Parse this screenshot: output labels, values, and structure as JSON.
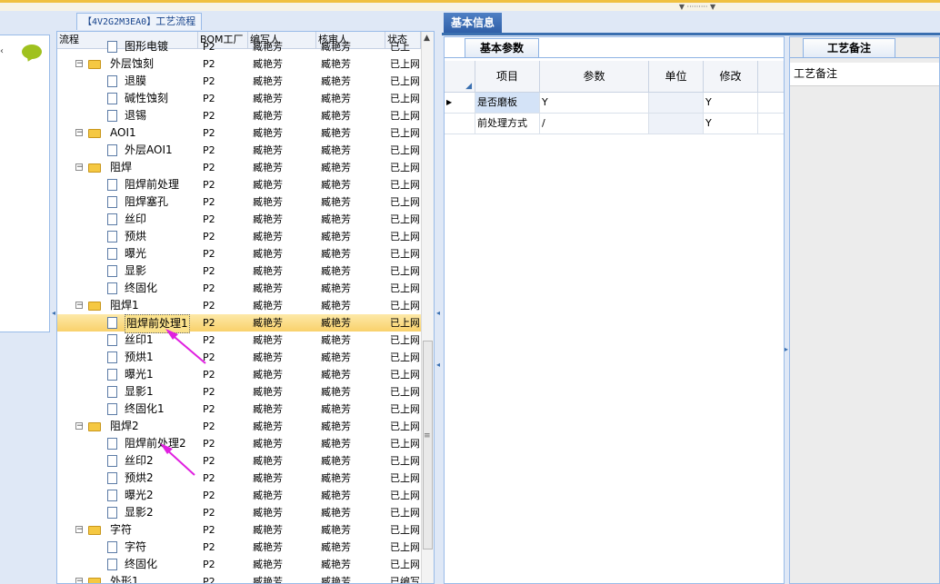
{
  "colors": {
    "accent": "#3a6fb0",
    "selected_row": "#f9d16b",
    "folder": "#f5c842",
    "annotation_arrow": "#e020e0"
  },
  "tree_panel": {
    "title_code": "【4V2G2M3EA0】",
    "title_text": "工艺流程",
    "headers": [
      "流程",
      "BOM工厂",
      "编写人",
      "核审人",
      "状态"
    ],
    "rows": [
      {
        "level": 1,
        "type": "doc",
        "name": "图形电镀",
        "bom": "P2",
        "writer": "臧艳芳",
        "reviewer": "臧艳芳",
        "status": "已上"
      },
      {
        "level": 0,
        "type": "folder",
        "name": "外层蚀刻",
        "bom": "P2",
        "writer": "臧艳芳",
        "reviewer": "臧艳芳",
        "status": "已上网"
      },
      {
        "level": 1,
        "type": "doc",
        "name": "退膜",
        "bom": "P2",
        "writer": "臧艳芳",
        "reviewer": "臧艳芳",
        "status": "已上网"
      },
      {
        "level": 1,
        "type": "doc",
        "name": "碱性蚀刻",
        "bom": "P2",
        "writer": "臧艳芳",
        "reviewer": "臧艳芳",
        "status": "已上网"
      },
      {
        "level": 1,
        "type": "doc",
        "name": "退锡",
        "bom": "P2",
        "writer": "臧艳芳",
        "reviewer": "臧艳芳",
        "status": "已上网"
      },
      {
        "level": 0,
        "type": "folder",
        "name": "AOI1",
        "bom": "P2",
        "writer": "臧艳芳",
        "reviewer": "臧艳芳",
        "status": "已上网"
      },
      {
        "level": 1,
        "type": "doc",
        "name": "外层AOI1",
        "bom": "P2",
        "writer": "臧艳芳",
        "reviewer": "臧艳芳",
        "status": "已上网"
      },
      {
        "level": 0,
        "type": "folder",
        "name": "阻焊",
        "bom": "P2",
        "writer": "臧艳芳",
        "reviewer": "臧艳芳",
        "status": "已上网"
      },
      {
        "level": 1,
        "type": "doc",
        "name": "阻焊前处理",
        "bom": "P2",
        "writer": "臧艳芳",
        "reviewer": "臧艳芳",
        "status": "已上网"
      },
      {
        "level": 1,
        "type": "doc",
        "name": "阻焊塞孔",
        "bom": "P2",
        "writer": "臧艳芳",
        "reviewer": "臧艳芳",
        "status": "已上网"
      },
      {
        "level": 1,
        "type": "doc",
        "name": "丝印",
        "bom": "P2",
        "writer": "臧艳芳",
        "reviewer": "臧艳芳",
        "status": "已上网"
      },
      {
        "level": 1,
        "type": "doc",
        "name": "预烘",
        "bom": "P2",
        "writer": "臧艳芳",
        "reviewer": "臧艳芳",
        "status": "已上网"
      },
      {
        "level": 1,
        "type": "doc",
        "name": "曝光",
        "bom": "P2",
        "writer": "臧艳芳",
        "reviewer": "臧艳芳",
        "status": "已上网"
      },
      {
        "level": 1,
        "type": "doc",
        "name": "显影",
        "bom": "P2",
        "writer": "臧艳芳",
        "reviewer": "臧艳芳",
        "status": "已上网"
      },
      {
        "level": 1,
        "type": "doc",
        "name": "终固化",
        "bom": "P2",
        "writer": "臧艳芳",
        "reviewer": "臧艳芳",
        "status": "已上网"
      },
      {
        "level": 0,
        "type": "folder",
        "name": "阻焊1",
        "bom": "P2",
        "writer": "臧艳芳",
        "reviewer": "臧艳芳",
        "status": "已上网"
      },
      {
        "level": 1,
        "type": "doc",
        "name": "阻焊前处理1",
        "bom": "P2",
        "writer": "臧艳芳",
        "reviewer": "臧艳芳",
        "status": "已上网",
        "selected": true
      },
      {
        "level": 1,
        "type": "doc",
        "name": "丝印1",
        "bom": "P2",
        "writer": "臧艳芳",
        "reviewer": "臧艳芳",
        "status": "已上网"
      },
      {
        "level": 1,
        "type": "doc",
        "name": "预烘1",
        "bom": "P2",
        "writer": "臧艳芳",
        "reviewer": "臧艳芳",
        "status": "已上网"
      },
      {
        "level": 1,
        "type": "doc",
        "name": "曝光1",
        "bom": "P2",
        "writer": "臧艳芳",
        "reviewer": "臧艳芳",
        "status": "已上网"
      },
      {
        "level": 1,
        "type": "doc",
        "name": "显影1",
        "bom": "P2",
        "writer": "臧艳芳",
        "reviewer": "臧艳芳",
        "status": "已上网"
      },
      {
        "level": 1,
        "type": "doc",
        "name": "终固化1",
        "bom": "P2",
        "writer": "臧艳芳",
        "reviewer": "臧艳芳",
        "status": "已上网"
      },
      {
        "level": 0,
        "type": "folder",
        "name": "阻焊2",
        "bom": "P2",
        "writer": "臧艳芳",
        "reviewer": "臧艳芳",
        "status": "已上网"
      },
      {
        "level": 1,
        "type": "doc",
        "name": "阻焊前处理2",
        "bom": "P2",
        "writer": "臧艳芳",
        "reviewer": "臧艳芳",
        "status": "已上网"
      },
      {
        "level": 1,
        "type": "doc",
        "name": "丝印2",
        "bom": "P2",
        "writer": "臧艳芳",
        "reviewer": "臧艳芳",
        "status": "已上网"
      },
      {
        "level": 1,
        "type": "doc",
        "name": "预烘2",
        "bom": "P2",
        "writer": "臧艳芳",
        "reviewer": "臧艳芳",
        "status": "已上网"
      },
      {
        "level": 1,
        "type": "doc",
        "name": "曝光2",
        "bom": "P2",
        "writer": "臧艳芳",
        "reviewer": "臧艳芳",
        "status": "已上网"
      },
      {
        "level": 1,
        "type": "doc",
        "name": "显影2",
        "bom": "P2",
        "writer": "臧艳芳",
        "reviewer": "臧艳芳",
        "status": "已上网"
      },
      {
        "level": 0,
        "type": "folder",
        "name": "字符",
        "bom": "P2",
        "writer": "臧艳芳",
        "reviewer": "臧艳芳",
        "status": "已上网"
      },
      {
        "level": 1,
        "type": "doc",
        "name": "字符",
        "bom": "P2",
        "writer": "臧艳芳",
        "reviewer": "臧艳芳",
        "status": "已上网"
      },
      {
        "level": 1,
        "type": "doc",
        "name": "终固化",
        "bom": "P2",
        "writer": "臧艳芳",
        "reviewer": "臧艳芳",
        "status": "已上网"
      },
      {
        "level": 0,
        "type": "folder",
        "name": "外形1",
        "bom": "P2",
        "writer": "臧艳芳",
        "reviewer": "臧艳芳",
        "status": "已编写"
      }
    ]
  },
  "right_panel": {
    "main_tab": "基本信息",
    "params_tab": "基本参数",
    "notes_tab": "工艺备注",
    "params_headers": [
      "项目",
      "参数",
      "单位",
      "修改"
    ],
    "params_rows": [
      {
        "item": "是否磨板",
        "param": "Y",
        "unit": "",
        "modify": "Y",
        "current": true
      },
      {
        "item": "前处理方式",
        "param": "/",
        "unit": "",
        "modify": "Y",
        "current": false
      }
    ],
    "notes_label": "工艺备注"
  }
}
